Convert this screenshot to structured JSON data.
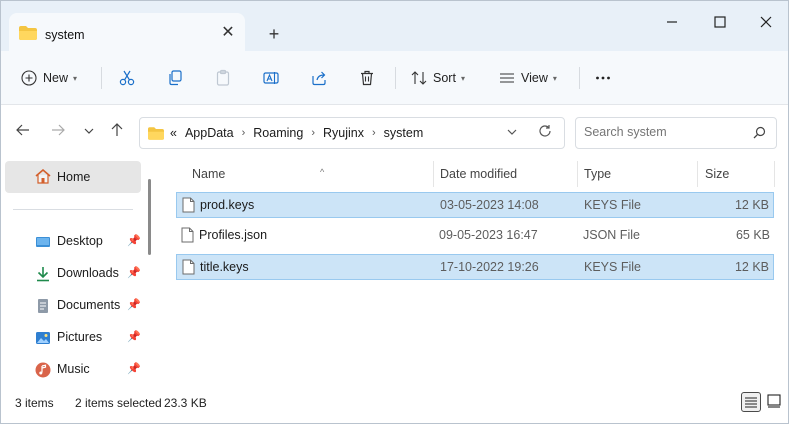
{
  "tab": {
    "title": "system",
    "close_glyph": "✕",
    "new_tab_glyph": "+"
  },
  "window_controls": {
    "minimize": "—",
    "maximize": "☐",
    "close": "✕"
  },
  "toolbar": {
    "new_label": "New",
    "sort_label": "Sort",
    "view_label": "View",
    "more_glyph": "···",
    "dropdown_glyph": "⌄"
  },
  "address": {
    "overflow": "«",
    "crumbs": [
      "AppData",
      "Roaming",
      "Ryujinx",
      "system"
    ],
    "separator": "›"
  },
  "search": {
    "placeholder": "Search system"
  },
  "sidebar": {
    "home": "Home",
    "items": [
      {
        "label": "Desktop",
        "icon": "desktop-icon"
      },
      {
        "label": "Downloads",
        "icon": "download-icon"
      },
      {
        "label": "Documents",
        "icon": "documents-icon"
      },
      {
        "label": "Pictures",
        "icon": "pictures-icon"
      },
      {
        "label": "Music",
        "icon": "music-icon"
      }
    ]
  },
  "columns": {
    "name": "Name",
    "date": "Date modified",
    "type": "Type",
    "size": "Size"
  },
  "files": [
    {
      "name": "prod.keys",
      "date": "03-05-2023 14:08",
      "type": "KEYS File",
      "size": "12 KB",
      "selected": true
    },
    {
      "name": "Profiles.json",
      "date": "09-05-2023 16:47",
      "type": "JSON File",
      "size": "65 KB",
      "selected": false
    },
    {
      "name": "title.keys",
      "date": "17-10-2022 19:26",
      "type": "KEYS File",
      "size": "12 KB",
      "selected": true
    }
  ],
  "status": {
    "count": "3 items",
    "selected": "2 items selected",
    "size": "23.3 KB"
  },
  "colors": {
    "accent": "#0067c0",
    "selection": "#cce4f7",
    "folder": "#f4c542",
    "titlebar": "#e8f0f8"
  }
}
